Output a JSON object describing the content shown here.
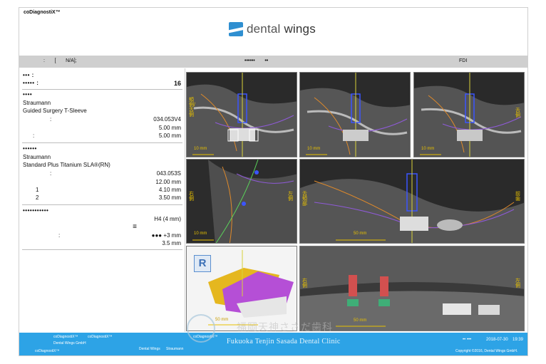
{
  "app": {
    "title": "coDiagnostiX™"
  },
  "logo": {
    "word1": "dental ",
    "word2": "wings"
  },
  "bar": {
    "left_text": ":       [       N/A];",
    "center_text": "••••••       ••",
    "right_text": "FDI"
  },
  "left_panel": {
    "header": {
      "label1": "•••   :",
      "label2": "•••••      :",
      "tooth_value": "16"
    },
    "sleeve": {
      "section": "••••",
      "brand": "Straumann",
      "name": "Guided Surgery T-Sleeve",
      "art_label": ":",
      "art_value": "034.053V4",
      "value2": "5.00 mm",
      "label3": ":",
      "value3": "5.00 mm"
    },
    "implant": {
      "section": "••••••",
      "brand": "Straumann",
      "name": "Standard Plus Titanium SLA®(RN)",
      "art_label": ":",
      "art_value": "043.053S",
      "value2": "12.00 mm",
      "label3": "1",
      "value3": "4.10 mm",
      "label4": "2",
      "value4": "3.50 mm"
    },
    "guide": {
      "section": "•••••••••••",
      "value1": "H4 (4 mm)",
      "glyph": "≡",
      "label3": ":",
      "value3": "●●● +3 mm",
      "value4": "3.5 mm"
    }
  },
  "panels": {
    "p1_left_label": "頬側/舌側",
    "p1_scale": "10 mm",
    "p2_scale": "10 mm",
    "p3_right_label": "舌側",
    "p3_scale": "10 mm",
    "p4_left_label": "右側",
    "p4_right_label": "左側",
    "p4_scale": "10 mm",
    "p5_left_label": "舌頬部",
    "p5_right_label": "前歯",
    "p5_scale": "50 mm",
    "p6_badge": "R",
    "p6_scale": "50 mm",
    "p7_left_label": "右側",
    "p7_right_label": "左側",
    "p7_scale": "50 mm"
  },
  "footer": {
    "t1": "coDiagnostiX™",
    "t2": "coDiagnostiX™",
    "t3": "Dental Wings GmbH",
    "t4": "coDiagnostiX™",
    "t5": "Dental Wings",
    "t6": "Straumann",
    "t7": "coDiagnostiX™",
    "right_dots": "••  •••",
    "date": "2018-07-30",
    "time": "19:39",
    "copyright": "Copyright ©2016, Dental Wings GmbH."
  },
  "watermark": {
    "clinic_en": "Fukuoka Tenjin Sasada Dental Clinic",
    "clinic_jp": "福岡天神ささだ歯科"
  },
  "colors": {
    "footer": "#2da3e6",
    "bar": "#cfcfcf",
    "accent_yellow": "#e8c100",
    "logo_blue": "#2f8fd1"
  }
}
